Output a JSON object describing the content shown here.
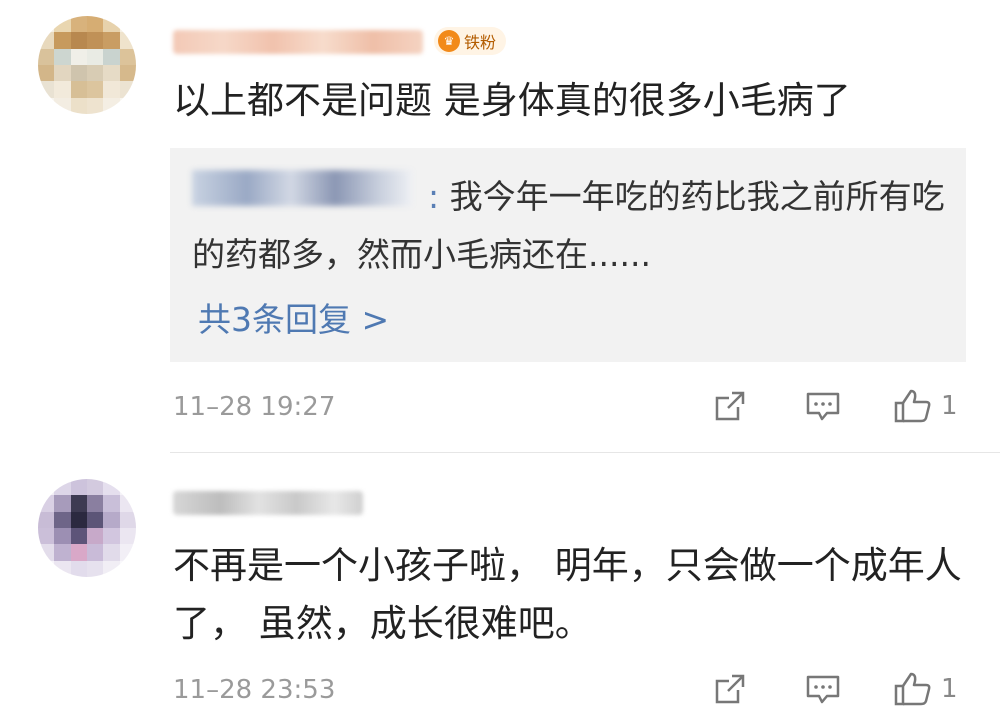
{
  "comments": [
    {
      "badge": "铁粉",
      "text": "以上都不是问题 是身体真的很多小毛病了",
      "reply": {
        "text": "我今年一年吃的药比我之前所有吃的药都多，然而小毛病还在......",
        "more_label": "共3条回复 >"
      },
      "time": "11–28 19:27",
      "like_count": "1",
      "icons": [
        "share-icon",
        "comment-icon",
        "like-icon"
      ]
    },
    {
      "text": "不再是一个小孩子啦， 明年，只会做一个成年人了， 虽然，成长很难吧。",
      "time": "11–28 23:53",
      "like_count": "1",
      "icons": [
        "share-icon",
        "comment-icon",
        "like-icon"
      ]
    }
  ],
  "colors": {
    "link_blue": "#4f79b2",
    "meta_gray": "#9a9a9a",
    "reply_bg": "#f2f2f2",
    "badge_orange": "#f28a1a"
  }
}
